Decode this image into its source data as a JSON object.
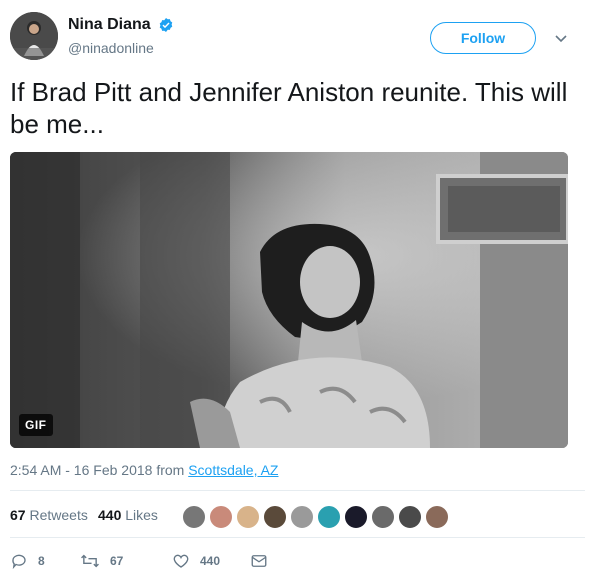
{
  "user": {
    "display_name": "Nina Diana",
    "handle": "@ninadonline",
    "follow_label": "Follow"
  },
  "tweet": {
    "text": "If Brad Pitt and Jennifer Aniston reunite. This will be me...",
    "media_badge": "GIF"
  },
  "meta": {
    "time": "2:54 AM - 16 Feb 2018",
    "from_text": "from",
    "place": "Scottsdale, AZ"
  },
  "stats": {
    "retweets_count": "67",
    "retweets_label": "Retweets",
    "likes_count": "440",
    "likes_label": "Likes"
  },
  "actions": {
    "reply_count": "8",
    "retweet_count": "67",
    "like_count": "440"
  },
  "colors": {
    "accent": "#1da1f2",
    "secondary_text": "#657786",
    "divider": "#e6ecf0"
  },
  "icons": [
    "verified-badge-icon",
    "chevron-down-icon",
    "reply-icon",
    "retweet-icon",
    "heart-icon",
    "direct-message-icon"
  ]
}
